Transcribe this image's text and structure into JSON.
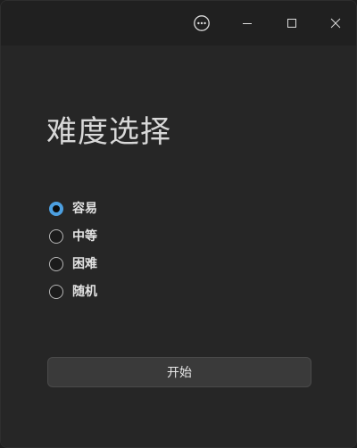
{
  "window": {
    "title_buttons": {
      "more_icon": "more-horizontal-circle-icon",
      "minimize_icon": "minimize-icon",
      "maximize_icon": "maximize-icon",
      "close_icon": "close-icon"
    }
  },
  "main": {
    "title": "难度选择",
    "difficulty_options": [
      {
        "label": "容易",
        "selected": true
      },
      {
        "label": "中等",
        "selected": false
      },
      {
        "label": "困难",
        "selected": false
      },
      {
        "label": "随机",
        "selected": false
      }
    ],
    "start_button_label": "开始"
  },
  "colors": {
    "accent": "#4c9fe0",
    "background": "#262626",
    "titlebar": "#202020",
    "button": "#3a3a3a"
  }
}
